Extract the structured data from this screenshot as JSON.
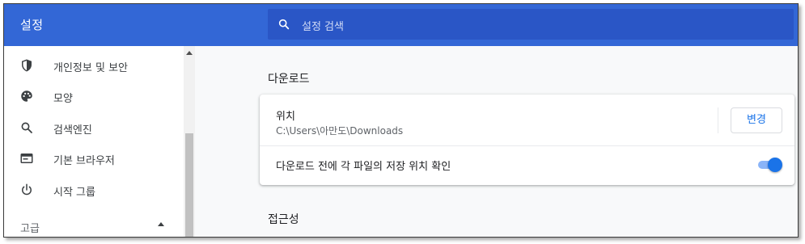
{
  "header": {
    "title": "설정",
    "search": {
      "placeholder": "설정 검색",
      "icon": "search-icon"
    }
  },
  "sidebar": {
    "items": [
      {
        "label": "개인정보 및 보안",
        "icon": "shield-icon"
      },
      {
        "label": "모양",
        "icon": "palette-icon"
      },
      {
        "label": "검색엔진",
        "icon": "search-icon"
      },
      {
        "label": "기본 브라우저",
        "icon": "browser-window-icon"
      },
      {
        "label": "시작 그룹",
        "icon": "power-icon"
      }
    ],
    "advanced_label": "고급"
  },
  "main": {
    "downloads_title": "다운로드",
    "location_label": "위치",
    "location_path": "C:\\Users\\아만도\\Downloads",
    "change_button": "변경",
    "ask_where_label": "다운로드 전에 각 파일의 저장 위치 확인",
    "ask_where_enabled": true,
    "accessibility_title": "접근성"
  },
  "colors": {
    "header": "#3367d6",
    "search_box": "#2a56c6",
    "accent": "#1a73e8"
  }
}
